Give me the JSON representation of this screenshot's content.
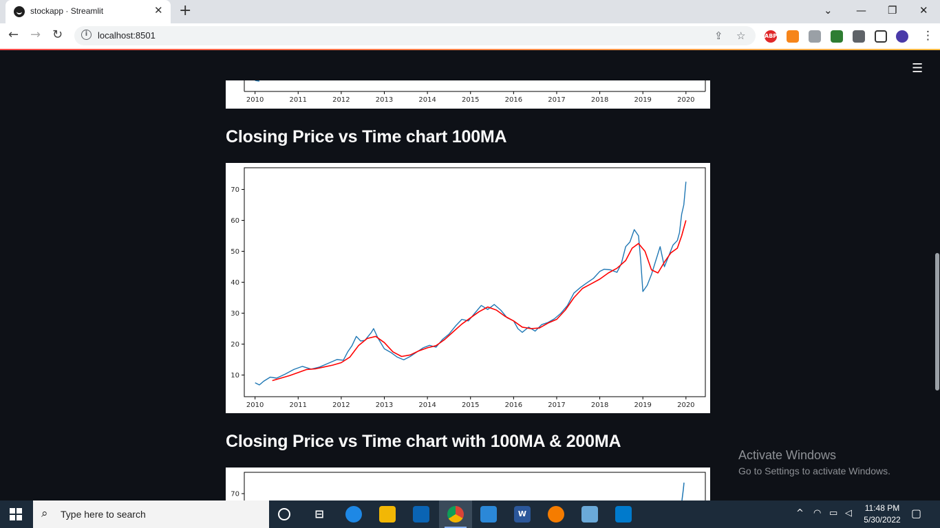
{
  "browser": {
    "tab_title": "stockapp · Streamlit",
    "url": "localhost:8501",
    "extensions": [
      "ABP"
    ]
  },
  "app": {
    "headings": [
      "Closing Price vs Time chart 100MA",
      "Closing Price vs Time chart with 100MA & 200MA"
    ]
  },
  "chart_data": [
    {
      "type": "line",
      "note_visible_portion": "bottom of previous chart (x axis only)",
      "x_ticks": [
        "2010",
        "2011",
        "2012",
        "2013",
        "2014",
        "2015",
        "2016",
        "2017",
        "2018",
        "2019",
        "2020"
      ]
    },
    {
      "type": "line",
      "title": "",
      "xlabel": "",
      "ylabel": "",
      "x_ticks": [
        "2010",
        "2011",
        "2012",
        "2013",
        "2014",
        "2015",
        "2016",
        "2017",
        "2018",
        "2019",
        "2020"
      ],
      "y_ticks": [
        10,
        20,
        30,
        40,
        50,
        60,
        70
      ],
      "xlim": [
        2009.75,
        2020.45
      ],
      "ylim": [
        3,
        77
      ],
      "series": [
        {
          "color": "#1f77b4",
          "x": [
            2010.0,
            2010.1,
            2010.2,
            2010.35,
            2010.5,
            2010.7,
            2010.9,
            2011.1,
            2011.3,
            2011.5,
            2011.7,
            2011.9,
            2012.05,
            2012.15,
            2012.25,
            2012.35,
            2012.45,
            2012.55,
            2012.7,
            2012.75,
            2012.85,
            2013.0,
            2013.15,
            2013.3,
            2013.45,
            2013.6,
            2013.75,
            2013.9,
            2014.05,
            2014.2,
            2014.35,
            2014.5,
            2014.65,
            2014.8,
            2014.95,
            2015.1,
            2015.25,
            2015.4,
            2015.55,
            2015.7,
            2015.85,
            2016.0,
            2016.1,
            2016.2,
            2016.35,
            2016.5,
            2016.65,
            2016.8,
            2016.95,
            2017.1,
            2017.25,
            2017.4,
            2017.55,
            2017.7,
            2017.85,
            2018.0,
            2018.1,
            2018.25,
            2018.4,
            2018.5,
            2018.6,
            2018.7,
            2018.8,
            2018.9,
            2018.95,
            2019.0,
            2019.1,
            2019.2,
            2019.3,
            2019.4,
            2019.5,
            2019.6,
            2019.7,
            2019.8,
            2019.85,
            2019.9,
            2019.95,
            2020.0
          ],
          "values": [
            7.5,
            6.8,
            8.0,
            9.3,
            9.0,
            10.3,
            11.8,
            12.8,
            11.9,
            12.6,
            13.8,
            15.0,
            14.8,
            17.5,
            19.5,
            22.5,
            21.0,
            21.2,
            23.8,
            25.0,
            22.0,
            18.5,
            17.3,
            15.8,
            14.9,
            16.0,
            17.4,
            18.8,
            19.6,
            19.0,
            21.5,
            23.2,
            25.8,
            28.0,
            27.5,
            30.0,
            32.5,
            31.2,
            32.8,
            31.0,
            28.5,
            27.5,
            25.0,
            23.8,
            25.5,
            24.2,
            26.3,
            27.0,
            28.2,
            30.0,
            32.5,
            36.5,
            38.3,
            39.8,
            41.2,
            43.5,
            44.2,
            44.0,
            43.2,
            46.0,
            51.5,
            53.0,
            57.0,
            55.0,
            47.0,
            37.0,
            39.0,
            42.5,
            47.0,
            51.5,
            45.0,
            48.5,
            52.0,
            53.5,
            56.0,
            62.0,
            65.0,
            72.5
          ]
        },
        {
          "color": "#ff0000",
          "x": [
            2010.4,
            2010.6,
            2010.8,
            2011.0,
            2011.2,
            2011.4,
            2011.6,
            2011.8,
            2012.0,
            2012.2,
            2012.4,
            2012.6,
            2012.8,
            2013.0,
            2013.2,
            2013.4,
            2013.6,
            2013.8,
            2014.0,
            2014.2,
            2014.4,
            2014.6,
            2014.8,
            2015.0,
            2015.2,
            2015.4,
            2015.6,
            2015.8,
            2016.0,
            2016.2,
            2016.4,
            2016.6,
            2016.8,
            2017.0,
            2017.2,
            2017.4,
            2017.6,
            2017.8,
            2018.0,
            2018.2,
            2018.4,
            2018.6,
            2018.75,
            2018.9,
            2019.05,
            2019.2,
            2019.35,
            2019.5,
            2019.65,
            2019.8,
            2019.9,
            2020.0
          ],
          "values": [
            8.2,
            9.0,
            9.8,
            10.8,
            11.8,
            12.0,
            12.6,
            13.2,
            14.0,
            15.8,
            19.5,
            21.8,
            22.5,
            20.5,
            17.5,
            16.0,
            16.5,
            17.8,
            18.8,
            19.5,
            21.5,
            24.0,
            26.5,
            28.5,
            30.5,
            32.0,
            31.0,
            29.0,
            27.5,
            25.5,
            25.0,
            25.2,
            26.8,
            28.0,
            31.0,
            35.0,
            38.0,
            39.5,
            41.0,
            43.0,
            44.5,
            47.0,
            51.0,
            52.5,
            50.0,
            44.0,
            43.0,
            46.5,
            49.5,
            51.0,
            55.0,
            60.0
          ]
        }
      ]
    },
    {
      "type": "line",
      "note_visible_portion": "top of next chart",
      "y_ticks": [
        70
      ]
    }
  ],
  "watermark": {
    "line1": "Activate Windows",
    "line2": "Go to Settings to activate Windows."
  },
  "taskbar": {
    "search_placeholder": "Type here to search",
    "time": "11:48 PM",
    "date": "5/30/2022"
  }
}
